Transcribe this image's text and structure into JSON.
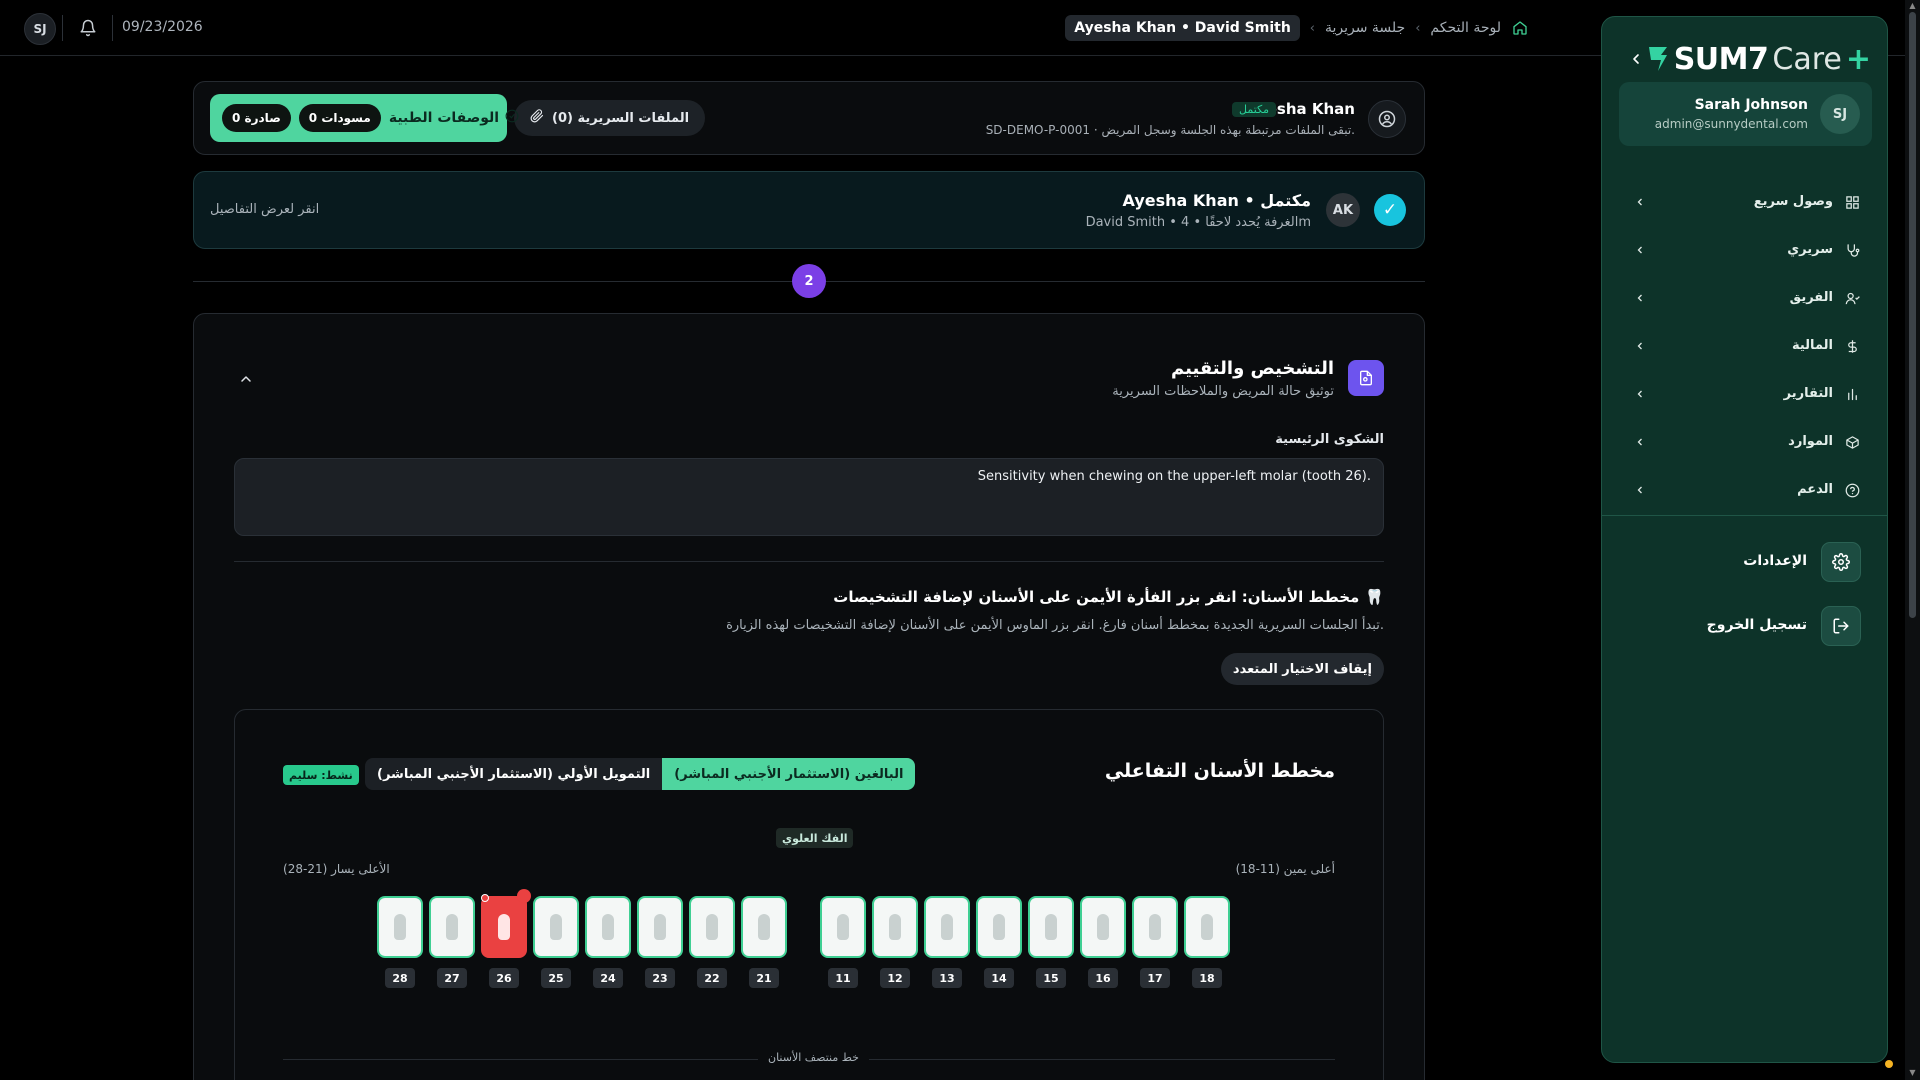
{
  "topbar": {
    "avatar_initials": "SJ",
    "date": "09/23/2026",
    "breadcrumbs": [
      "لوحة التحكم",
      "جلسة سريرية"
    ],
    "current": "Ayesha Khan • David Smith"
  },
  "sidebar": {
    "logo_text": "SUM7",
    "logo_care": "Care",
    "logo_plus": "+",
    "user": {
      "initials": "SJ",
      "name": "Sarah Johnson",
      "email": "admin@sunnydental.com"
    },
    "items": [
      {
        "label": "وصول سريع",
        "icon": "grid-icon"
      },
      {
        "label": "سريري",
        "icon": "stethoscope-icon"
      },
      {
        "label": "الفريق",
        "icon": "users-icon"
      },
      {
        "label": "المالية",
        "icon": "dollar-icon"
      },
      {
        "label": "التقارير",
        "icon": "bar-chart-icon"
      },
      {
        "label": "الموارد",
        "icon": "box-icon"
      },
      {
        "label": "الدعم",
        "icon": "help-icon"
      }
    ],
    "settings_label": "الإعدادات",
    "logout_label": "تسجيل الخروج"
  },
  "patient": {
    "name": "Ayesha Khan",
    "status_badge": "مكتمل",
    "subtitle": "SD-DEMO-P-0001 · تبقى الملفات مرتبطة بهذه الجلسة وسجل المريض.",
    "files_label": "الملفات السريرية (0)",
    "rx_label": "الوصفات الطبية",
    "rx_drafts": "0 مسودات",
    "rx_issued": "0 صادرة"
  },
  "session": {
    "check": "✓",
    "avatar": "AK",
    "title": "Ayesha Khan • مكتمل",
    "subtitle": "David Smith • الغرفة يُحدد لاحقًا • 4m",
    "hint": "انقر لعرض التفاصيل"
  },
  "step": {
    "number": "2"
  },
  "diagnosis": {
    "title": "التشخيص والتقييم",
    "subtitle": "توثيق حالة المريض والملاحظات السريرية",
    "chief_complaint_label": "الشكوى الرئيسية",
    "chief_complaint_value": "Sensitivity when chewing on the upper-left molar (tooth 26).",
    "chart_title": "مخطط الأسنان: انقر بزر الفأرة الأيمن على الأسنان لإضافة التشخيصات",
    "chart_emoji": "🦷",
    "chart_subtitle": "تبدأ الجلسات السريرية الجديدة بمخطط أسنان فارغ. انقر بزر الماوس الأيمن على الأسنان لإضافة التشخيصات لهذه الزيارة.",
    "stop_multi_label": "إيقاف الاختيار المتعدد"
  },
  "tooth_chart": {
    "title": "مخطط الأسنان التفاعلي",
    "tabs": [
      "البالغين (الاستثمار الأجنبي المباشر)",
      "التمويل الأولي (الاستثمار الأجنبي المباشر)"
    ],
    "active_tab": 0,
    "active_badge": "نشط: سليم",
    "jaw_label": "الفك العلوي",
    "upper_right_label": "أعلى يمين (11-18)",
    "upper_left_label": "الأعلى يسار (21-28)",
    "midline_label": "خط منتصف الأسنان",
    "left_teeth": [
      "28",
      "27",
      "26",
      "25",
      "24",
      "23",
      "22",
      "21"
    ],
    "right_teeth": [
      "11",
      "12",
      "13",
      "14",
      "15",
      "16",
      "17",
      "18"
    ],
    "selected_tooth": "26",
    "colors": {
      "healthy_border": "#3fcf93",
      "selected": "#ea4141",
      "accent": "#4fd59f"
    }
  }
}
